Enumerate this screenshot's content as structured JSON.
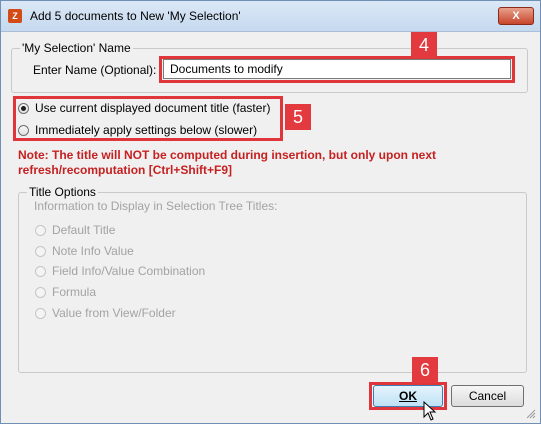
{
  "window": {
    "title": "Add 5 documents to New 'My Selection'",
    "close_label": "X"
  },
  "name_group": {
    "legend": "'My Selection' Name",
    "label": "Enter Name (Optional):",
    "value": "Documents to modify"
  },
  "title_mode": {
    "options": [
      {
        "label": "Use current displayed document title (faster)",
        "checked": true
      },
      {
        "label": "Immediately apply settings below (slower)",
        "checked": false
      }
    ]
  },
  "note": "Note: The title will NOT be computed during insertion, but only upon next refresh/recomputation [Ctrl+Shift+F9]",
  "title_options": {
    "legend": "Title Options",
    "info_label": "Information to Display in Selection Tree Titles:",
    "options": [
      "Default Title",
      "Note Info Value",
      "Field Info/Value Combination",
      "Formula",
      "Value from View/Folder"
    ]
  },
  "buttons": {
    "ok": "OK",
    "cancel": "Cancel"
  },
  "callouts": {
    "step4": "4",
    "step5": "5",
    "step6": "6",
    "color": "#e23a3f"
  },
  "icons": [
    "app-icon",
    "close-icon",
    "mouse-cursor-icon",
    "resize-grip-icon"
  ]
}
